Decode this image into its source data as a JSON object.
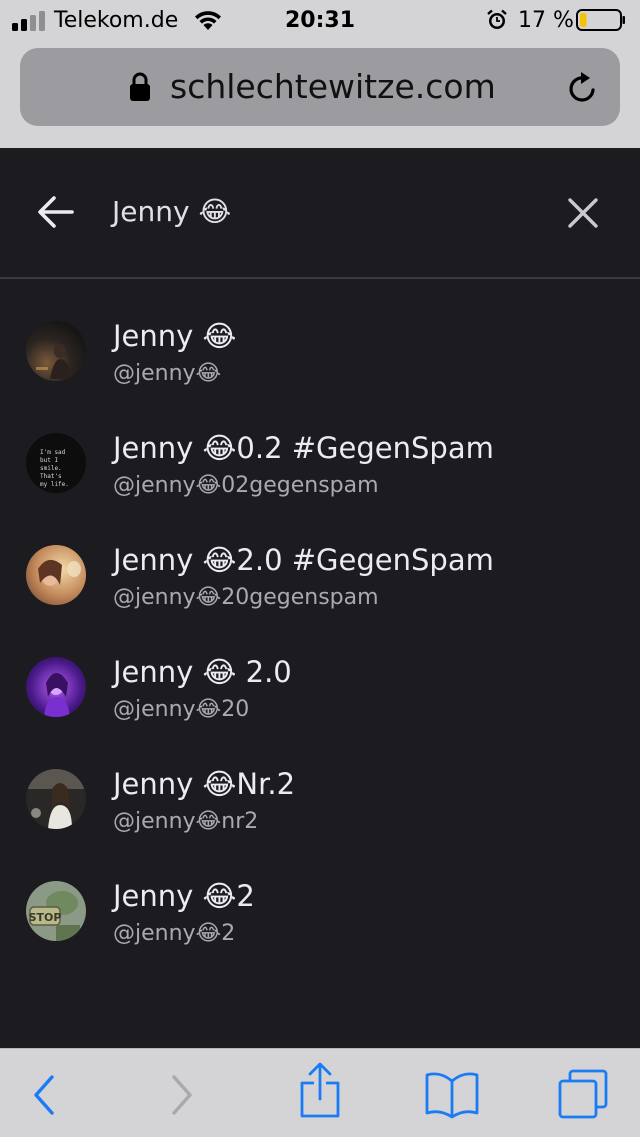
{
  "status_bar": {
    "carrier": "Telekom.de",
    "time": "20:31",
    "battery_percent": "17 %",
    "battery_level": 0.17,
    "icons": [
      "signal-icon",
      "wifi-icon",
      "alarm-icon",
      "battery-icon"
    ]
  },
  "browser": {
    "url": "schlechtewitze.com",
    "icons": [
      "lock-icon",
      "reload-icon"
    ]
  },
  "search": {
    "query": "Jenny 😂",
    "icons": [
      "back-arrow-icon",
      "close-icon"
    ]
  },
  "results": [
    {
      "name": "Jenny 😂",
      "handle": "@jenny😂"
    },
    {
      "name": "Jenny 😂0.2 #GegenSpam",
      "handle": "@jenny😂02gegenspam",
      "avatar_text": "I'm sad but I smile. That's my life."
    },
    {
      "name": "Jenny 😂2.0 #GegenSpam",
      "handle": "@jenny😂20gegenspam"
    },
    {
      "name": "Jenny 😂 2.0",
      "handle": "@jenny😂20"
    },
    {
      "name": "Jenny 😂Nr.2",
      "handle": "@jenny😂nr2"
    },
    {
      "name": "Jenny 😂2",
      "handle": "@jenny😂2",
      "avatar_text": "STOP"
    }
  ],
  "toolbar": {
    "icons": [
      "back-icon",
      "forward-icon",
      "share-icon",
      "bookmarks-icon",
      "tabs-icon"
    ],
    "accent_color": "#1a7cf5",
    "disabled_color": "#a8a8ad"
  },
  "colors": {
    "background": "#1c1c20",
    "bars": "#d4d4d6",
    "text_primary": "#ececf0",
    "text_secondary": "#a9a9b0"
  }
}
